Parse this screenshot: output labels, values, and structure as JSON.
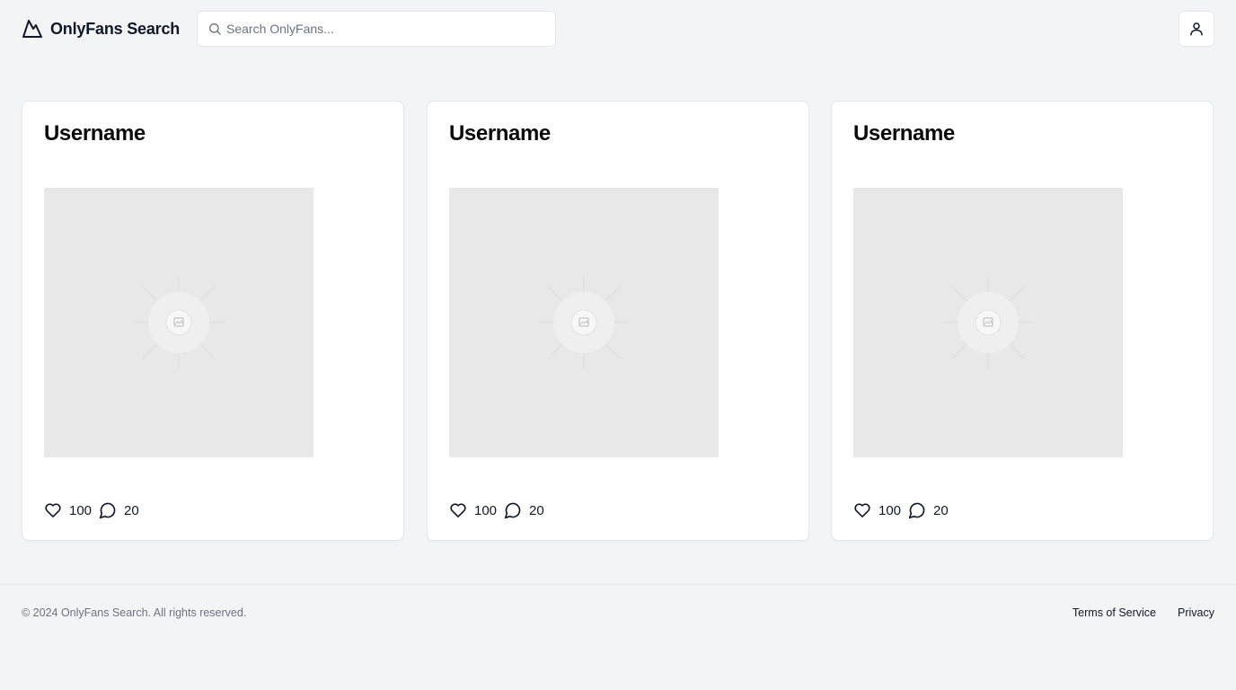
{
  "header": {
    "brand_name": "OnlyFans Search",
    "brand_icon": "mountain-icon",
    "search_placeholder": "Search OnlyFans...",
    "search_value": "",
    "search_icon": "search-icon",
    "user_icon": "user-icon"
  },
  "cards": [
    {
      "username": "Username",
      "image_icon": "image-placeholder-icon",
      "likes": "100",
      "comments": "20",
      "like_icon": "heart-icon",
      "comment_icon": "message-circle-icon"
    },
    {
      "username": "Username",
      "image_icon": "image-placeholder-icon",
      "likes": "100",
      "comments": "20",
      "like_icon": "heart-icon",
      "comment_icon": "message-circle-icon"
    },
    {
      "username": "Username",
      "image_icon": "image-placeholder-icon",
      "likes": "100",
      "comments": "20",
      "like_icon": "heart-icon",
      "comment_icon": "message-circle-icon"
    }
  ],
  "footer": {
    "copyright": "© 2024 OnlyFans Search. All rights reserved.",
    "links": [
      "Terms of Service",
      "Privacy"
    ]
  },
  "colors": {
    "background": "#f3f4f6",
    "card": "#ffffff",
    "border": "#e5e7eb",
    "text": "#111827",
    "muted_text": "#6b7280",
    "image_placeholder": "#e8e8e8"
  }
}
